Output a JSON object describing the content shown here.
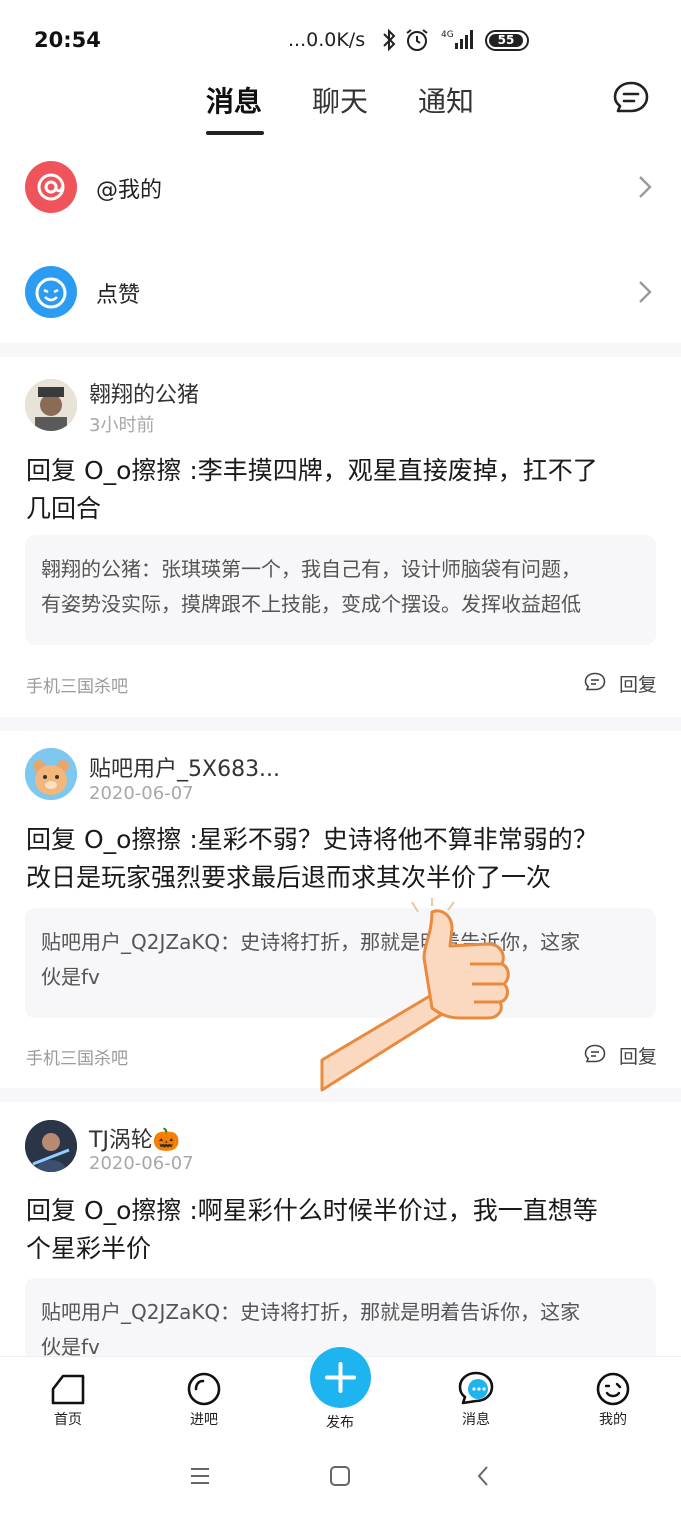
{
  "status_bar": {
    "time": "20:54",
    "network_speed": "...0.0K/s",
    "network_type": "4G",
    "battery": "55"
  },
  "top_tabs": [
    {
      "label": "消息",
      "active": true
    },
    {
      "label": "聊天",
      "active": false
    },
    {
      "label": "通知",
      "active": false
    }
  ],
  "entries": [
    {
      "label": "@我的",
      "icon": "at-icon",
      "color": "#f0545b"
    },
    {
      "label": "点赞",
      "icon": "like-face-icon",
      "color": "#2b9cf2"
    }
  ],
  "posts": [
    {
      "username": "翱翔的公猪",
      "time": "3小时前",
      "reply_line1": "回复 O_o擦擦 :李丰摸四牌，观星直接废掉，扛不了",
      "reply_line2": "几回合",
      "quote_line1": "翱翔的公猪：张琪瑛第一个，我自己有，设计师脑袋有问题，",
      "quote_line2": "有姿势没实际，摸牌跟不上技能，变成个摆设。发挥收益超低",
      "forum": "手机三国杀吧",
      "reply_label": "回复"
    },
    {
      "username": "贴吧用户_5X683...",
      "time": "2020-06-07",
      "reply_line1": "回复 O_o擦擦 :星彩不弱？史诗将他不算非常弱的？",
      "reply_line2": "改日是玩家强烈要求最后退而求其次半价了一次",
      "quote_line1": "贴吧用户_Q2JZaKQ：史诗将打折，那就是明着告诉你，这家",
      "quote_line2": "伙是fv",
      "forum": "手机三国杀吧",
      "reply_label": "回复"
    },
    {
      "username": "TJ涡轮🎃",
      "time": "2020-06-07",
      "reply_line1": "回复 O_o擦擦 :啊星彩什么时候半价过，我一直想等",
      "reply_line2": "个星彩半价",
      "quote_line1": "贴吧用户_Q2JZaKQ：史诗将打折，那就是明着告诉你，这家",
      "quote_line2": "伙是fv"
    }
  ],
  "bottom_nav": [
    {
      "label": "首页",
      "icon": "home-icon"
    },
    {
      "label": "进吧",
      "icon": "enter-bar-icon"
    },
    {
      "label": "发布",
      "icon": "plus-icon"
    },
    {
      "label": "消息",
      "icon": "message-icon"
    },
    {
      "label": "我的",
      "icon": "profile-face-icon"
    }
  ],
  "colors": {
    "accent": "#1eb4f0",
    "at_red": "#f0545b",
    "like_blue": "#2b9cf2"
  }
}
